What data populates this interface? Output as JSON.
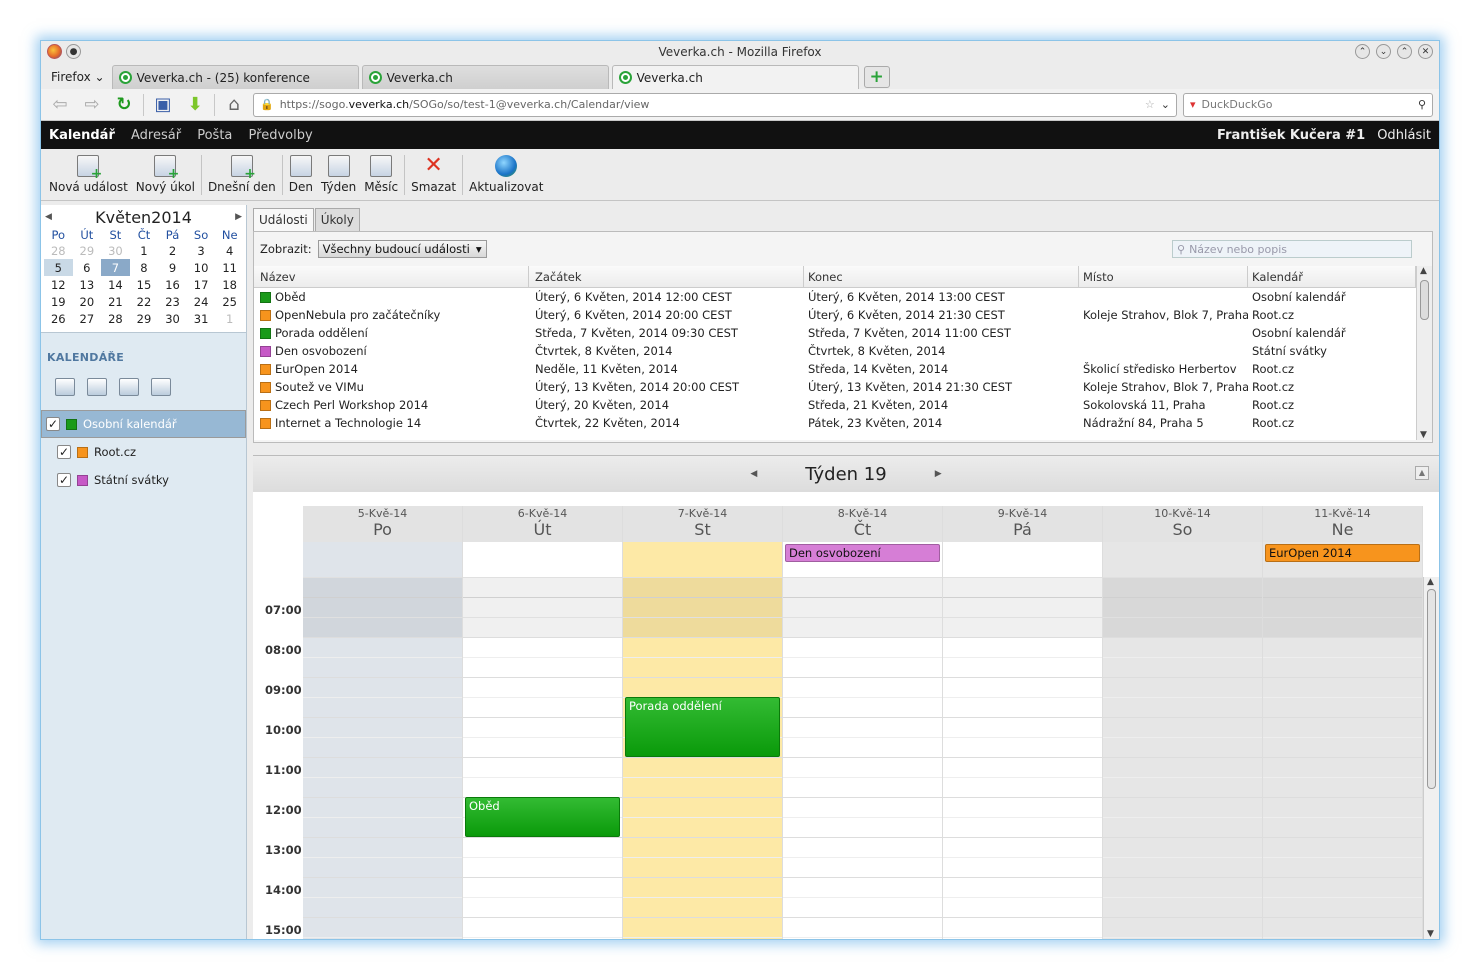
{
  "browser": {
    "title": "Veverka.ch - Mozilla Firefox",
    "menu_label": "Firefox",
    "tabs": [
      {
        "label": "Veverka.ch - (25) konference"
      },
      {
        "label": "Veverka.ch"
      },
      {
        "label": "Veverka.ch"
      }
    ],
    "url_prefix": "https://sogo.",
    "url_domain": "veverka.ch",
    "url_suffix": "/SOGo/so/test-1@veverka.ch/Calendar/view",
    "search_engine": "DuckDuckGo"
  },
  "app": {
    "nav": [
      "Kalendář",
      "Adresář",
      "Pošta",
      "Předvolby"
    ],
    "user": "František Kučera #1",
    "logout": "Odhlásit"
  },
  "toolbar": [
    "Nová událost",
    "Nový úkol",
    "Dnešní den",
    "Den",
    "Týden",
    "Měsíc",
    "Smazat",
    "Aktualizovat"
  ],
  "mini_calendar": {
    "month": "Květen",
    "year": "2014",
    "weekdays": [
      "Po",
      "Út",
      "St",
      "Čt",
      "Pá",
      "So",
      "Ne"
    ],
    "weeks": [
      [
        "28",
        "29",
        "30",
        "1",
        "2",
        "3",
        "4"
      ],
      [
        "5",
        "6",
        "7",
        "8",
        "9",
        "10",
        "11"
      ],
      [
        "12",
        "13",
        "14",
        "15",
        "16",
        "17",
        "18"
      ],
      [
        "19",
        "20",
        "21",
        "22",
        "23",
        "24",
        "25"
      ],
      [
        "26",
        "27",
        "28",
        "29",
        "30",
        "31",
        "1"
      ]
    ]
  },
  "calendars": {
    "heading": "KALENDÁŘE",
    "items": [
      {
        "name": "Osobní kalendář",
        "color": "#1a9a1a",
        "selected": true
      },
      {
        "name": "Root.cz",
        "color": "#f7941d",
        "selected": false
      },
      {
        "name": "Státní svátky",
        "color": "#c659c6",
        "selected": false
      }
    ]
  },
  "events_panel": {
    "tabs": [
      "Události",
      "Úkoly"
    ],
    "filter_label": "Zobrazit:",
    "filter_value": "Všechny budoucí události",
    "search_placeholder": "Název nebo popis",
    "columns": [
      "Název",
      "Začátek",
      "Konec",
      "Místo",
      "Kalendář"
    ],
    "rows": [
      {
        "name": "Oběd",
        "color": "#1a9a1a",
        "start": "Úterý, 6 Květen, 2014 12:00 CEST",
        "end": "Úterý, 6 Květen, 2014 13:00 CEST",
        "place": "",
        "calendar": "Osobní kalendář"
      },
      {
        "name": "OpenNebula pro začátečníky",
        "color": "#f7941d",
        "start": "Úterý, 6 Květen, 2014 20:00 CEST",
        "end": "Úterý, 6 Květen, 2014 21:30 CEST",
        "place": "Koleje Strahov, Blok 7, Praha",
        "calendar": "Root.cz"
      },
      {
        "name": "Porada oddělení",
        "color": "#1a9a1a",
        "start": "Středa, 7 Květen, 2014 09:30 CEST",
        "end": "Středa, 7 Květen, 2014 11:00 CEST",
        "place": "",
        "calendar": "Osobní kalendář"
      },
      {
        "name": "Den osvobození",
        "color": "#c659c6",
        "start": "Čtvrtek, 8 Květen, 2014",
        "end": "Čtvrtek, 8 Květen, 2014",
        "place": "",
        "calendar": "Státní svátky"
      },
      {
        "name": "EurOpen 2014",
        "color": "#f7941d",
        "start": "Neděle, 11 Květen, 2014",
        "end": "Středa, 14 Květen, 2014",
        "place": "Školicí středisko Herbertov",
        "calendar": "Root.cz"
      },
      {
        "name": "Soutež ve VIMu",
        "color": "#f7941d",
        "start": "Úterý, 13 Květen, 2014 20:00 CEST",
        "end": "Úterý, 13 Květen, 2014 21:30 CEST",
        "place": "Koleje Strahov, Blok 7, Praha",
        "calendar": "Root.cz"
      },
      {
        "name": "Czech Perl Workshop 2014",
        "color": "#f7941d",
        "start": "Úterý, 20 Květen, 2014",
        "end": "Středa, 21 Květen, 2014",
        "place": "Sokolovská 11, Praha",
        "calendar": "Root.cz"
      },
      {
        "name": "Internet a Technologie 14",
        "color": "#f7941d",
        "start": "Čtvrtek, 22 Květen, 2014",
        "end": "Pátek, 23 Květen, 2014",
        "place": "Nádražní 84, Praha 5",
        "calendar": "Root.cz"
      }
    ]
  },
  "week_view": {
    "title": "Týden 19",
    "days": [
      {
        "date": "5-Kvě-14",
        "name": "Po"
      },
      {
        "date": "6-Kvě-14",
        "name": "Út"
      },
      {
        "date": "7-Kvě-14",
        "name": "St"
      },
      {
        "date": "8-Kvě-14",
        "name": "Čt"
      },
      {
        "date": "9-Kvě-14",
        "name": "Pá"
      },
      {
        "date": "10-Kvě-14",
        "name": "So"
      },
      {
        "date": "11-Kvě-14",
        "name": "Ne"
      }
    ],
    "hours": [
      "07:00",
      "08:00",
      "09:00",
      "10:00",
      "11:00",
      "12:00",
      "13:00",
      "14:00",
      "15:00"
    ],
    "allday_events": [
      {
        "title": "Den osvobození",
        "day": 3,
        "color": "#d67ed6"
      },
      {
        "title": "EurOpen 2014",
        "day": 6,
        "color": "#f7941d"
      }
    ],
    "timed_events": [
      {
        "title": "Porada oddělení",
        "day": 2,
        "start": 9.5,
        "end": 11.0
      },
      {
        "title": "Oběd",
        "day": 1,
        "start": 12.0,
        "end": 13.0
      }
    ]
  }
}
